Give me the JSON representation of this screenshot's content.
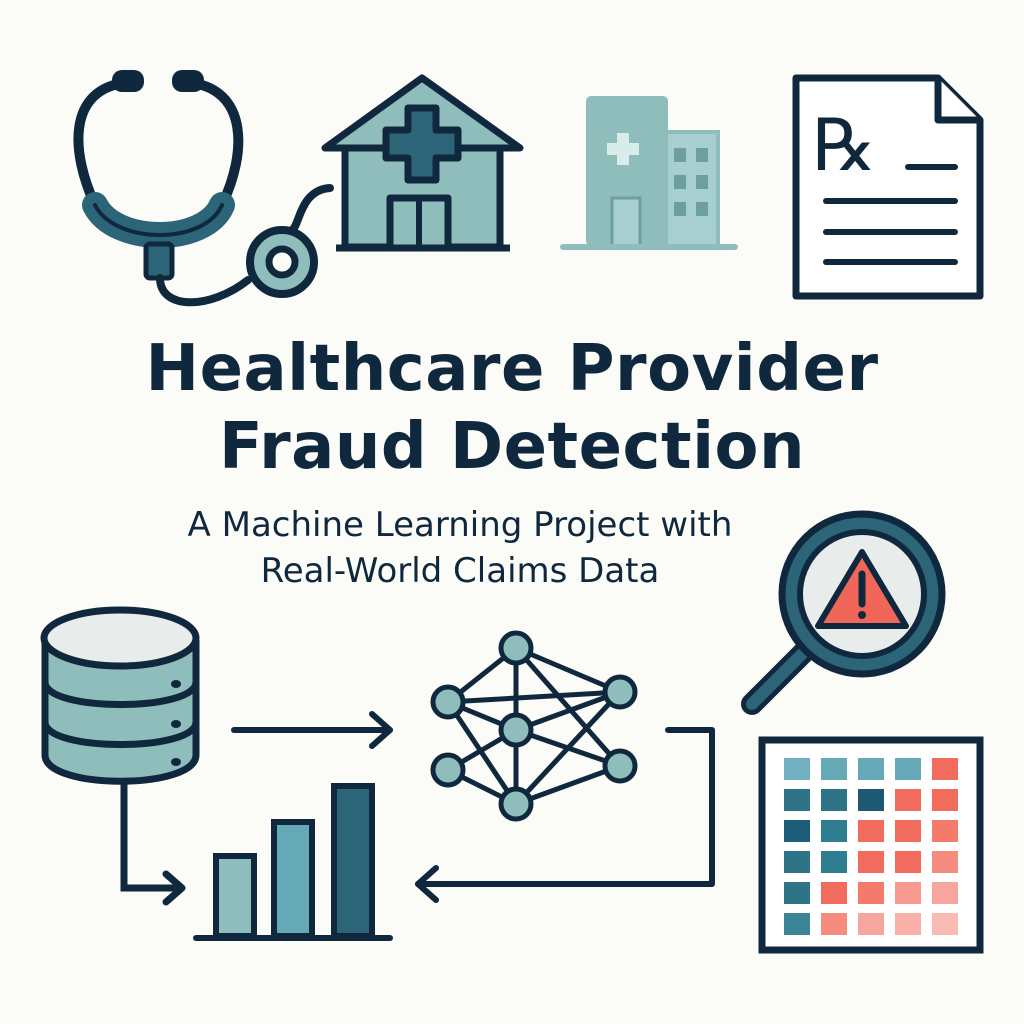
{
  "title": {
    "line1": "Healthcare Provider",
    "line2": "Fraud Detection"
  },
  "subtitle": {
    "line1": "A Machine Learning Project with",
    "line2": "Real-World Claims Data"
  },
  "prescription": {
    "symbol": "℞"
  },
  "icons": [
    "stethoscope-icon",
    "house-medical-icon",
    "hospital-building-icon",
    "prescription-icon",
    "database-icon",
    "arrow-right-icon",
    "neural-network-icon",
    "magnifier-warning-icon",
    "bar-chart-icon",
    "heatmap-icon"
  ],
  "colors": {
    "ink": "#10283d",
    "teal_light": "#8fbdbb",
    "teal_mid": "#66a9b6",
    "teal_dark": "#2c6478",
    "coral": "#f0675a",
    "background": "#fbfbf8"
  },
  "heatmap": {
    "rows": [
      [
        "#71b1c1",
        "#66a9b6",
        "#66a9b6",
        "#66a9b6",
        "#f26c5e"
      ],
      [
        "#2f7387",
        "#2f7387",
        "#1b5a72",
        "#f26c5e",
        "#f26c5e"
      ],
      [
        "#1d5d78",
        "#2f7d90",
        "#f26c5e",
        "#f26c5e",
        "#f47a6c"
      ],
      [
        "#2f7387",
        "#2f7d90",
        "#f26c5e",
        "#f26c5e",
        "#f58c7f"
      ],
      [
        "#2f7387",
        "#f26c5e",
        "#f47a6c",
        "#f79b91",
        "#f7a69d"
      ],
      [
        "#3b8597",
        "#f58c7f",
        "#f7a69d",
        "#f8b0a8",
        "#f9bcb5"
      ]
    ]
  }
}
